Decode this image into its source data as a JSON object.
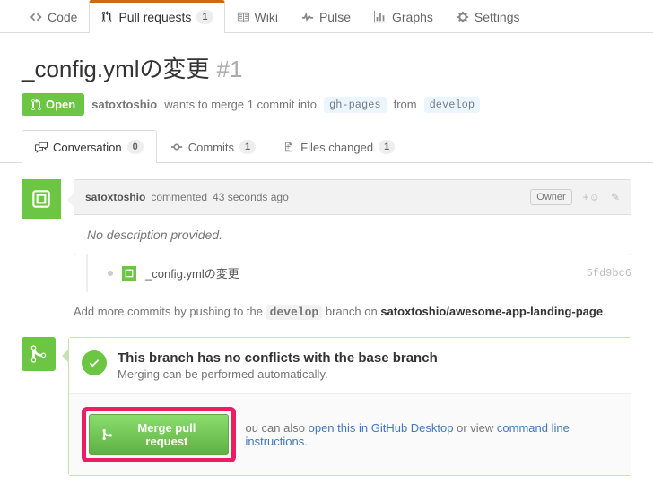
{
  "topnav": {
    "code": "Code",
    "pull_requests": "Pull requests",
    "pr_count": "1",
    "wiki": "Wiki",
    "pulse": "Pulse",
    "graphs": "Graphs",
    "settings": "Settings"
  },
  "pr": {
    "title": "_config.ymlの変更",
    "number": "#1",
    "state": "Open",
    "author": "satoxtoshio",
    "meta_wants": "wants to merge 1 commit into",
    "base": "gh-pages",
    "meta_from": "from",
    "head": "develop"
  },
  "subtabs": {
    "conversation": "Conversation",
    "conv_count": "0",
    "commits": "Commits",
    "commits_count": "1",
    "files": "Files changed",
    "files_count": "1"
  },
  "comment": {
    "author": "satoxtoshio",
    "verb": "commented",
    "time": "43 seconds ago",
    "owner": "Owner",
    "body": "No description provided."
  },
  "commit": {
    "message": "_config.ymlの変更",
    "sha": "5fd9bc6"
  },
  "push_hint": {
    "prefix": "Add more commits by pushing to the",
    "branch": "develop",
    "mid": "branch on",
    "repo": "satoxtoshio/awesome-app-landing-page"
  },
  "merge": {
    "title": "This branch has no conflicts with the base branch",
    "sub": "Merging can be performed automatically.",
    "button": "Merge pull request",
    "also_prefix": "ou can also",
    "desktop": "open this in GitHub Desktop",
    "or_view": "or view",
    "cli": "command line instructions"
  }
}
